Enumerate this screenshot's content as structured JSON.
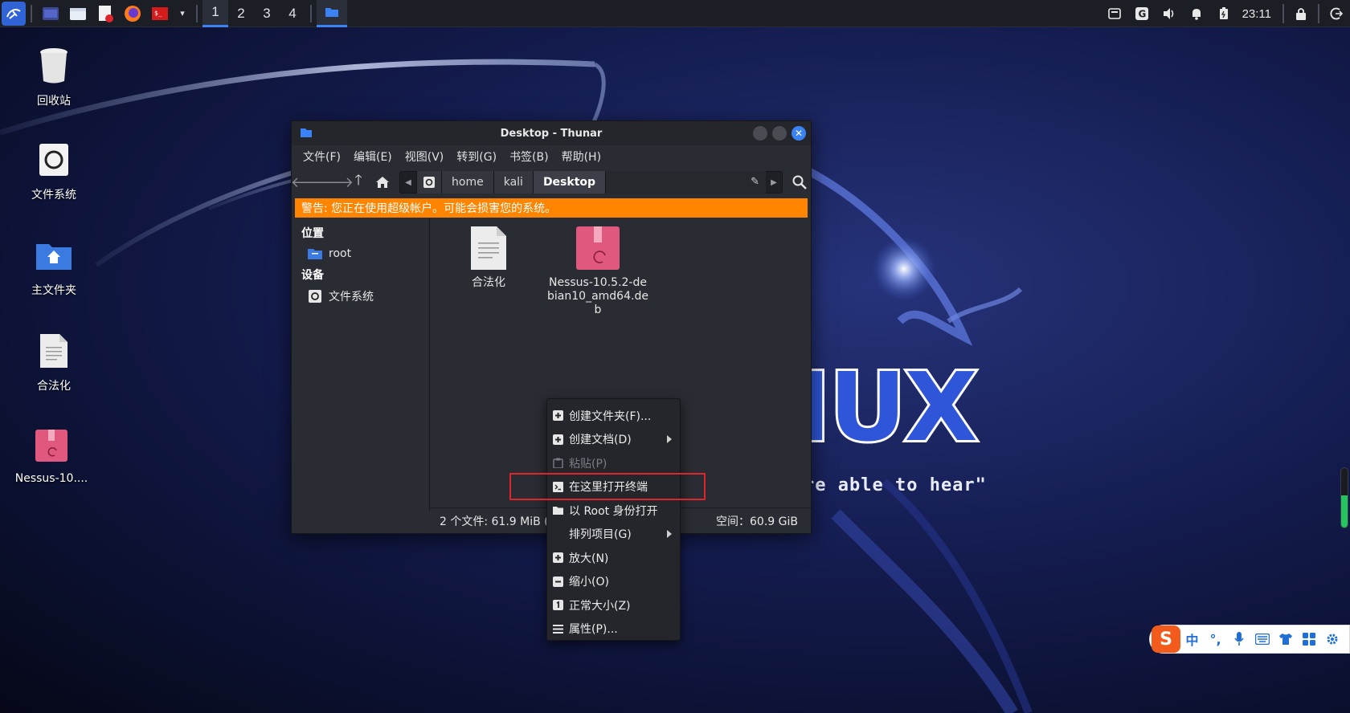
{
  "panel": {
    "workspaces": [
      "1",
      "2",
      "3",
      "4"
    ],
    "active_workspace": "1",
    "clock": "23:11",
    "icons": [
      "kali-menu-icon",
      "terminal-icon",
      "file-manager-icon",
      "text-editor-icon",
      "firefox-icon",
      "terminal-root-icon",
      "chevron-down-icon",
      "folder-icon",
      "network-icon",
      "g-icon",
      "volume-icon",
      "notification-icon",
      "battery-icon",
      "lock-icon",
      "logout-icon"
    ]
  },
  "desktop": {
    "icons": [
      {
        "label": "回收站",
        "icon": "trash-icon"
      },
      {
        "label": "文件系统",
        "icon": "filesystem-icon"
      },
      {
        "label": "主文件夹",
        "icon": "home-folder-icon"
      },
      {
        "label": "合法化",
        "icon": "text-file-icon"
      },
      {
        "label": "Nessus-10....",
        "icon": "deb-package-icon"
      }
    ],
    "wallpaper_logo": "IUX",
    "wallpaper_tagline": "re able to hear\""
  },
  "window": {
    "title": "Desktop - Thunar",
    "menu": [
      "文件(F)",
      "编辑(E)",
      "视图(V)",
      "转到(G)",
      "书签(B)",
      "帮助(H)"
    ],
    "path": [
      "home",
      "kali",
      "Desktop"
    ],
    "warning": "警告: 您正在使用超级帐户。可能会损害您的系统。",
    "sidebar": {
      "places_header": "位置",
      "places": [
        {
          "label": "root"
        }
      ],
      "devices_header": "设备",
      "devices": [
        {
          "label": "文件系统"
        }
      ]
    },
    "files": [
      {
        "name": "合法化",
        "type": "text"
      },
      {
        "name": "Nessus-10.5.2-debian10_amd64.deb",
        "type": "deb"
      }
    ],
    "status_left": "2 个文件: 61.9 MiB (",
    "status_right": "空间：60.9 GiB"
  },
  "context_menu": {
    "items": [
      {
        "label": "创建文件夹(F)...",
        "icon": "plus-icon",
        "submenu": false,
        "disabled": false
      },
      {
        "label": "创建文档(D)",
        "icon": "plus-icon",
        "submenu": true,
        "disabled": false
      },
      {
        "label": "粘贴(P)",
        "icon": "clipboard-icon",
        "submenu": false,
        "disabled": true
      },
      {
        "label": "在这里打开终端",
        "icon": "terminal-icon",
        "submenu": false,
        "disabled": false
      },
      {
        "label": "以 Root 身份打开",
        "icon": "folder-icon",
        "submenu": false,
        "disabled": false
      },
      {
        "label": "排列项目(G)",
        "icon": "",
        "submenu": true,
        "disabled": false
      },
      {
        "label": "放大(N)",
        "icon": "plus-icon",
        "submenu": false,
        "disabled": false
      },
      {
        "label": "缩小(O)",
        "icon": "minus-icon",
        "submenu": false,
        "disabled": false
      },
      {
        "label": "正常大小(Z)",
        "icon": "one-icon",
        "submenu": false,
        "disabled": false
      },
      {
        "label": "属性(P)...",
        "icon": "properties-icon",
        "submenu": false,
        "disabled": false
      }
    ],
    "highlighted": "在这里打开终端",
    "highlight_color": "#e0242b"
  },
  "ime": {
    "logo": "S",
    "mode": "中",
    "punct": "°,"
  },
  "colors": {
    "accent": "#3b82f6",
    "warning_bg": "#ff8400",
    "deb_pink": "#e0587e"
  }
}
